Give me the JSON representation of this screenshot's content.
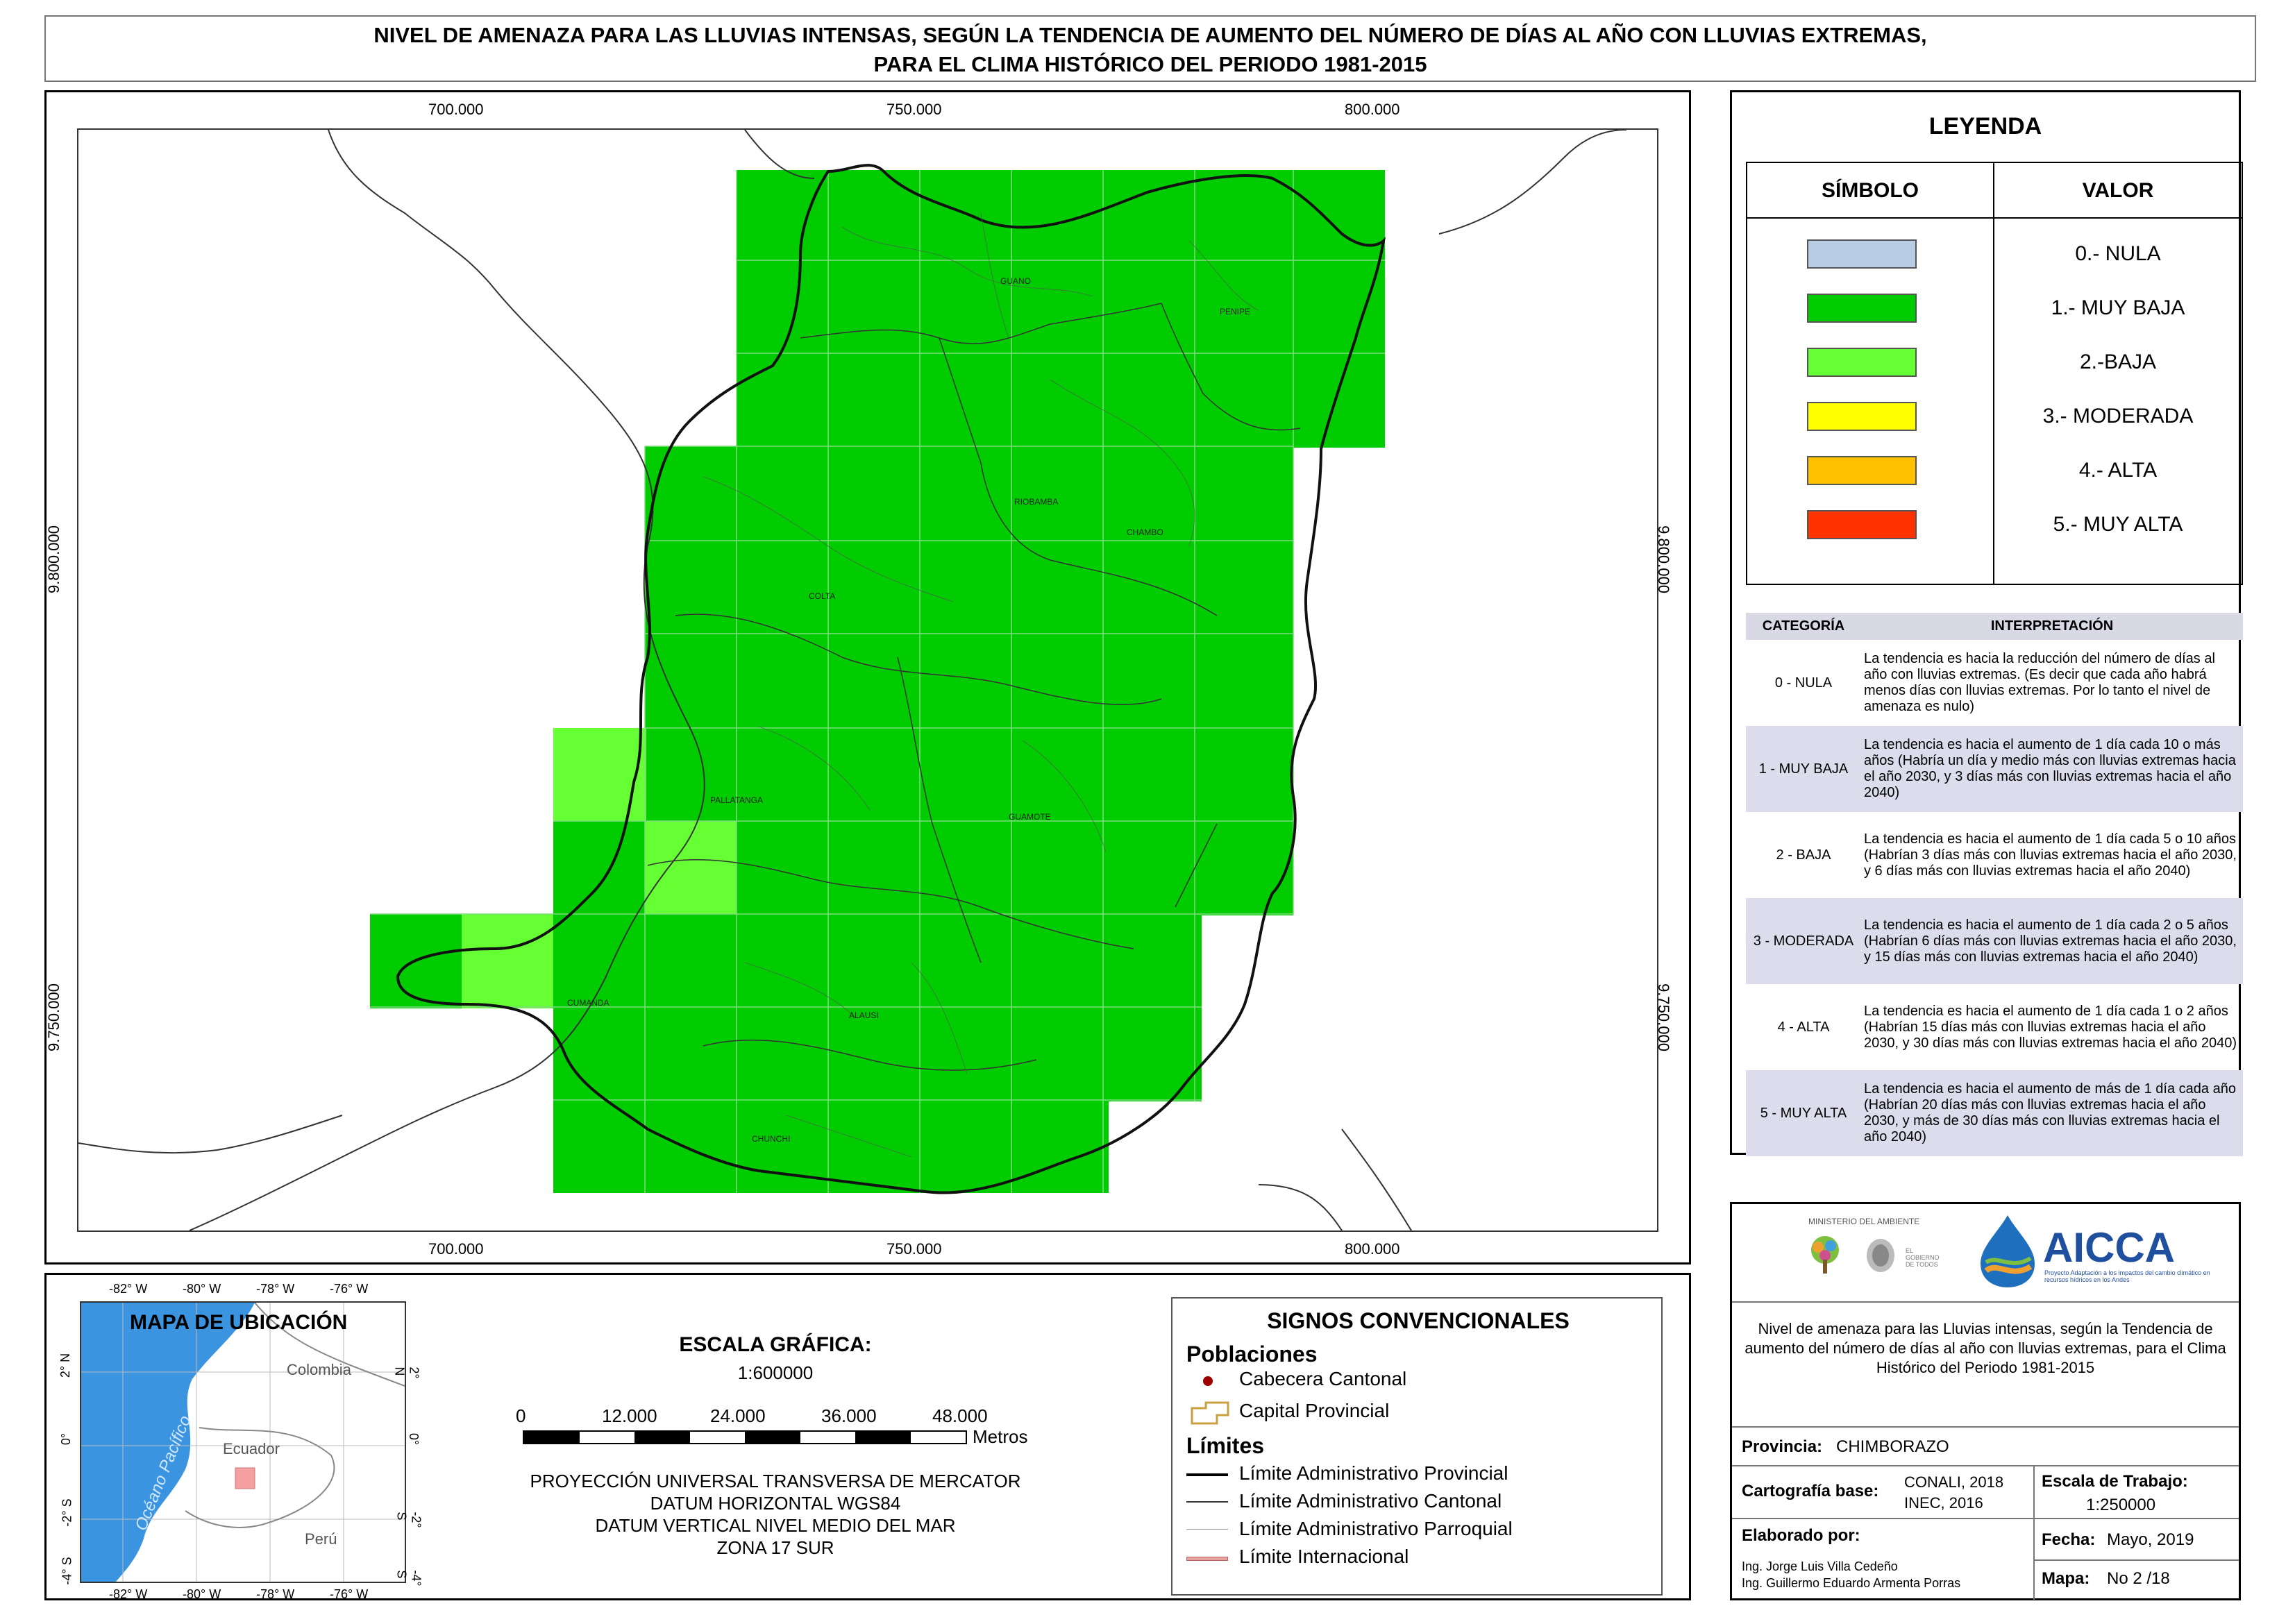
{
  "title": {
    "line1": "NIVEL DE AMENAZA PARA LAS LLUVIAS INTENSAS, SEGÚN LA TENDENCIA DE AUMENTO DEL NÚMERO DE DÍAS AL AÑO CON LLUVIAS EXTREMAS,",
    "line2": "PARA EL CLIMA HISTÓRICO DEL PERIODO 1981-2015"
  },
  "map": {
    "x_ticks": [
      "700.000",
      "750.000",
      "800.000"
    ],
    "y_ticks": [
      "9.800.000",
      "9.750.000"
    ],
    "municipalities": [
      "GUANO",
      "PENIPE",
      "RIOBAMBA",
      "CHAMBO",
      "COLTA",
      "PALLATANGA",
      "GUAMOTE",
      "CUMANDA",
      "ALAUSI",
      "CHUNCHI"
    ],
    "colors": {
      "muy_baja": "#00cc00",
      "baja": "#66ff33",
      "grid_line": "#7fdc7f"
    }
  },
  "legend": {
    "title": "LEYENDA",
    "col_symbol": "SÍMBOLO",
    "col_value": "VALOR",
    "items": [
      {
        "label": "0.- NULA",
        "color": "#b8cce4"
      },
      {
        "label": "1.- MUY BAJA",
        "color": "#00cc00"
      },
      {
        "label": "2.-BAJA",
        "color": "#66ff33"
      },
      {
        "label": "3.- MODERADA",
        "color": "#ffff00"
      },
      {
        "label": "4.- ALTA",
        "color": "#ffc000"
      },
      {
        "label": "5.- MUY ALTA",
        "color": "#ff3300"
      }
    ]
  },
  "interpretation": {
    "col_category": "CATEGORÍA",
    "col_interp": "INTERPRETACIÓN",
    "rows": [
      {
        "cat": "0 - NULA",
        "text": "La tendencia es hacia la reducción del número de días al año con lluvias extremas. (Es decir que cada año habrá menos días con lluvias extremas. Por lo tanto el nivel de amenaza es nulo)"
      },
      {
        "cat": "1 - MUY BAJA",
        "text": "La tendencia es hacia el aumento de 1 día cada 10 o más años (Habría un día y medio más con lluvias extremas hacia el año 2030, y 3 días más con lluvias extremas hacia el año 2040)"
      },
      {
        "cat": "2 - BAJA",
        "text": "La tendencia es hacia el aumento de 1 día cada 5 o 10 años (Habrían 3 días más con lluvias extremas hacia el año 2030, y 6 días más con lluvias extremas hacia el año 2040)"
      },
      {
        "cat": "3 - MODERADA",
        "text": "La tendencia es hacia el aumento de 1 día cada 2 o 5 años (Habrían 6 días más con lluvias extremas hacia el año 2030, y 15 días más con lluvias extremas hacia el año 2040)"
      },
      {
        "cat": "4 - ALTA",
        "text": "La tendencia es hacia el aumento de 1 día cada 1 o 2 años (Habrían 15 días más con lluvias extremas hacia el año 2030, y 30 días más con lluvias extremas hacia el año 2040)"
      },
      {
        "cat": "5 - MUY ALTA",
        "text": "La tendencia es hacia el aumento de más de 1 día cada año (Habrían 20 días más con lluvias extremas hacia el año 2030, y más de 30 días más con lluvias extremas hacia el año 2040)"
      }
    ]
  },
  "location_map": {
    "title": "MAPA DE UBICACIÓN",
    "lon_ticks": [
      "-82° W",
      "-80° W",
      "-78° W",
      "-76° W"
    ],
    "lat_ticks": [
      "2° N",
      "0°",
      "-2° S",
      "-4° S"
    ],
    "ocean": "Océano Pacífico",
    "countries": [
      "Colombia",
      "Ecuador",
      "Perú"
    ]
  },
  "scale": {
    "title": "ESCALA GRÁFICA:",
    "ratio": "1:600000",
    "ticks": [
      "0",
      "12.000",
      "24.000",
      "36.000",
      "48.000"
    ],
    "unit": "Metros",
    "projection": [
      "PROYECCIÓN UNIVERSAL TRANSVERSA DE MERCATOR",
      "DATUM HORIZONTAL WGS84",
      "DATUM VERTICAL NIVEL MEDIO DEL MAR",
      "ZONA 17 SUR"
    ]
  },
  "signs": {
    "title": "SIGNOS CONVENCIONALES",
    "populations_title": "Poblaciones",
    "populations": [
      "Cabecera Cantonal",
      "Capital Provincial"
    ],
    "limits_title": "Límites",
    "limits": [
      "Límite Administrativo Provincial",
      "Límite Administrativo Cantonal",
      "Límite Administrativo Parroquial",
      "Límite Internacional"
    ]
  },
  "info": {
    "ministry": "MINISTERIO DEL AMBIENTE",
    "gov_label": "EL GOBIERNO DE TODOS",
    "aicca": "AICCA",
    "aicca_sub": "Proyecto Adaptación a los impactos del cambio climático en recursos hídricos en los Andes",
    "description": "Nivel de amenaza para las Lluvias intensas, según la Tendencia de aumento del número de días al año con lluvias extremas, para el Clima Histórico del Periodo 1981-2015",
    "province_label": "Provincia:",
    "province": "CHIMBORAZO",
    "carto_label": "Cartografía base:",
    "carto_value1": "CONALI, 2018",
    "carto_value2": "INEC, 2016",
    "scale_label": "Escala de Trabajo:",
    "scale_value": "1:250000",
    "made_label": "Elaborado por:",
    "authors": [
      "Ing. Jorge Luis Villa Cedeño",
      "Ing. Guillermo Eduardo Armenta Porras"
    ],
    "date_label": "Fecha:",
    "date_value": "Mayo, 2019",
    "map_label": "Mapa:",
    "map_value": "No 2 /18"
  }
}
